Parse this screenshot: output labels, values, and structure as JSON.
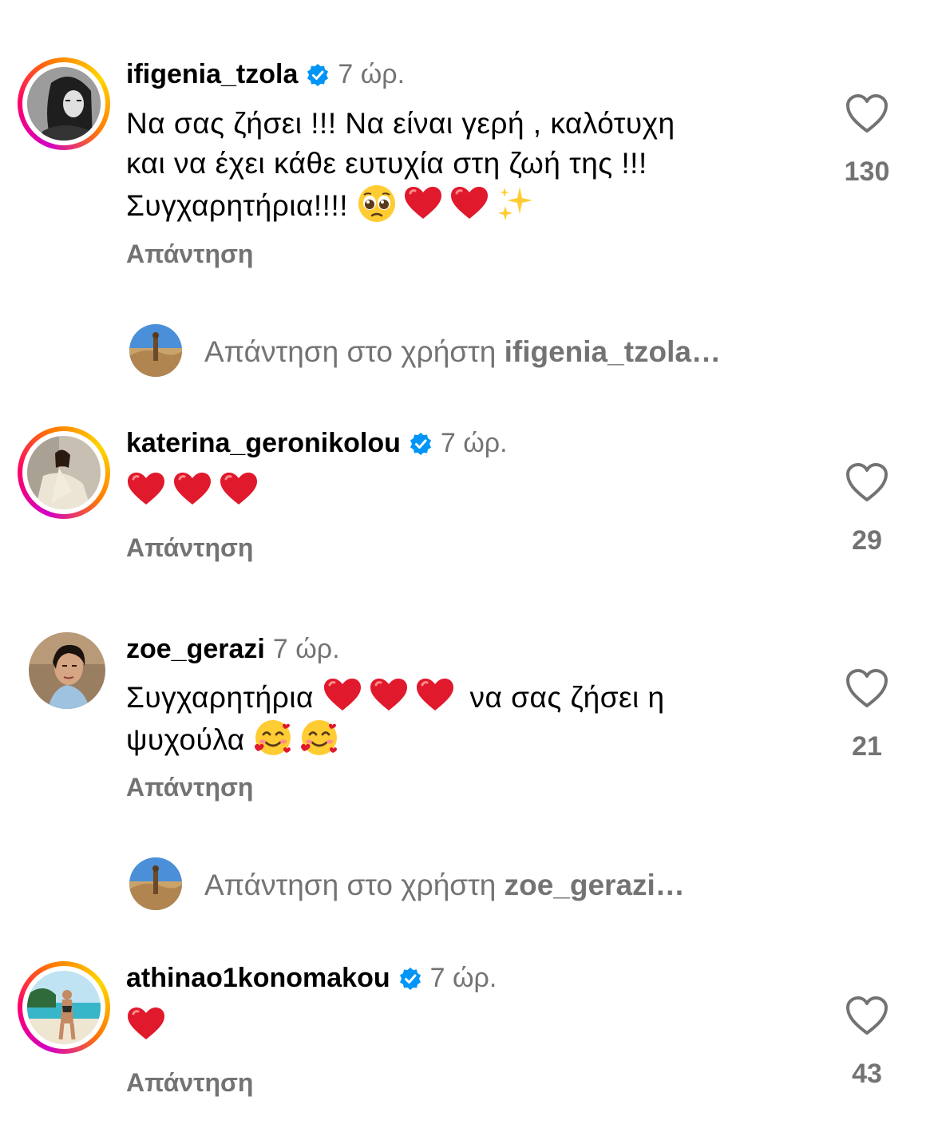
{
  "icons": {
    "verified": "verified-badge-icon",
    "like": "heart-outline-icon",
    "heart_emoji": "red-heart-emoji",
    "pleading": "pleading-face-emoji",
    "sparkles": "sparkles-emoji",
    "smiling_hearts": "smiling-face-with-hearts-emoji"
  },
  "colors": {
    "verified": "#0095f6",
    "muted": "#737373",
    "heart": "#e0192d"
  },
  "comments": [
    {
      "username": "ifigenia_tzola",
      "verified": true,
      "time": "7 ώρ.",
      "text_line1": "Να σας ζήσει !!! Να είναι γερή , καλότυχη",
      "text_line2": "και να έχει κάθε ευτυχία στη ζωή της !!!",
      "text_line3": "Συγχαρητήρια!!!!",
      "reply": "Απάντηση",
      "likes": "130"
    },
    {
      "username": "katerina_geronikolou",
      "verified": true,
      "time": "7 ώρ.",
      "reply": "Απάντηση",
      "likes": "29"
    },
    {
      "username": "zoe_gerazi",
      "verified": false,
      "time": "7 ώρ.",
      "text_line1_a": "Συγχαρητήρια",
      "text_line1_b": "να σας ζήσει η",
      "text_line2": "ψυχούλα",
      "reply": "Απάντηση",
      "likes": "21"
    },
    {
      "username": "athinao1konomakou",
      "verified": true,
      "time": "7 ώρ.",
      "reply": "Απάντηση",
      "likes": "43"
    }
  ],
  "reply_prompts": [
    {
      "prefix": "Απάντηση στο χρήστη",
      "target": "ifigenia_tzola…"
    },
    {
      "prefix": "Απάντηση στο χρήστη",
      "target": "zoe_gerazi…"
    }
  ]
}
